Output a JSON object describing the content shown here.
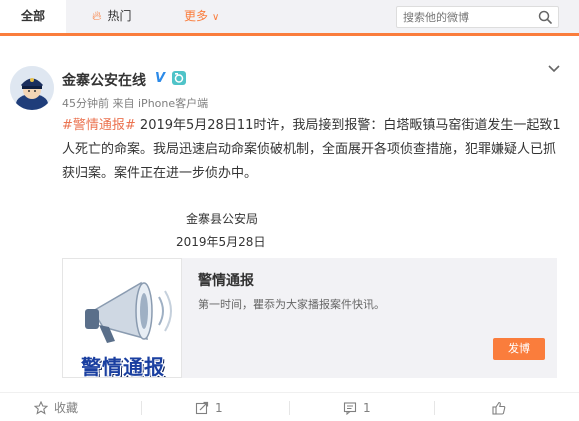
{
  "nav": {
    "tab_all": "全部",
    "tab_hot": "热门",
    "tab_more": "更多",
    "search_placeholder": "搜索他的微博"
  },
  "post": {
    "author": "金寨公安在线",
    "time": "45分钟前",
    "source_prefix": "来自",
    "source": "iPhone客户端",
    "hashtag": "#警情通报#",
    "text": " 2019年5月28日11时许，我局接到报警：白塔畈镇马窑街道发生一起致1人死亡的命案。我局迅速启动命案侦破机制，全面展开各项侦查措施，犯罪嫌疑人已抓获归案。案件正在进一步侦办中。",
    "signature_org": "金寨县公安局",
    "signature_date": "2019年5月28日"
  },
  "card": {
    "thumb_text": "警情通报",
    "title": "警情通报",
    "description": "第一时间，瞿忝为大家播报案件快讯。",
    "button": "发博"
  },
  "actions": {
    "favorite": "收藏",
    "repost": "1",
    "comment": "1",
    "like": ""
  },
  "colors": {
    "accent": "#fa7d3c",
    "hashtag": "#eb7350",
    "verified": "#2c8ae8"
  },
  "icons": {
    "hot": "flame-icon",
    "more": "chevron-down-icon",
    "search": "search-icon",
    "verified": "verified-v-icon",
    "member": "member-camera-icon",
    "post_menu": "chevron-down-icon",
    "favorite": "star-icon",
    "repost": "repost-icon",
    "comment": "comment-icon",
    "like": "thumbs-up-icon"
  }
}
